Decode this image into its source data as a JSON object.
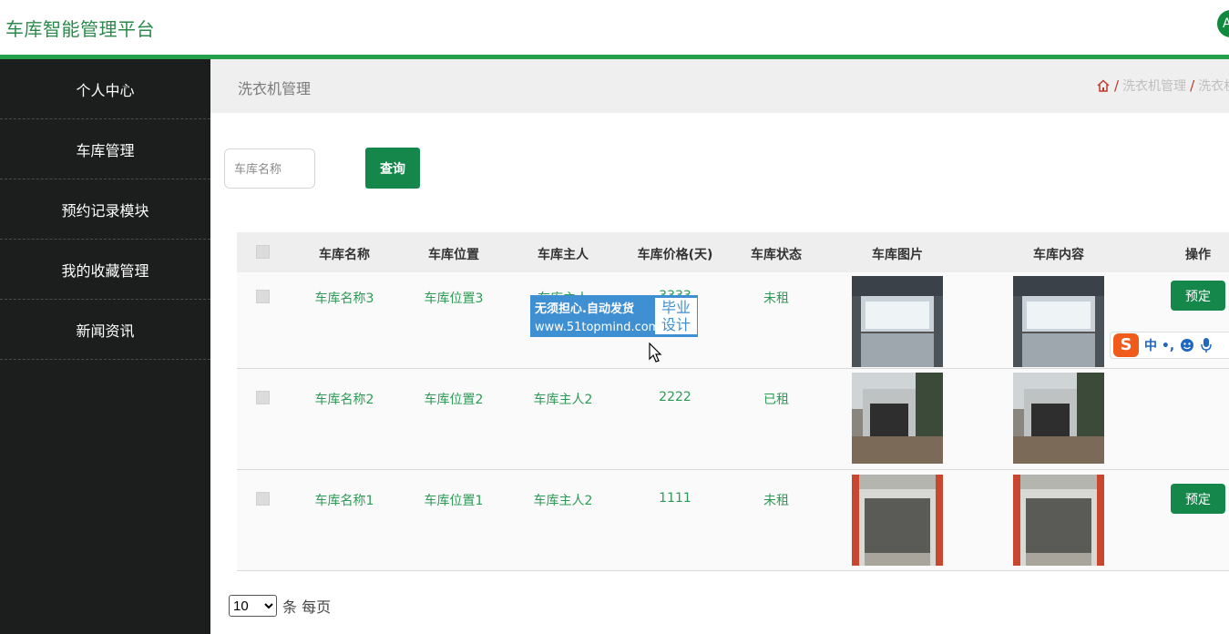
{
  "app": {
    "title": "车库智能管理平台",
    "avatar_letter": "A"
  },
  "sidebar": {
    "items": [
      {
        "label": "个人中心"
      },
      {
        "label": "车库管理"
      },
      {
        "label": "预约记录模块"
      },
      {
        "label": "我的收藏管理"
      },
      {
        "label": "新闻资讯"
      }
    ]
  },
  "page": {
    "title": "洗衣机管理",
    "breadcrumb": [
      "洗衣机管理",
      "洗衣机"
    ]
  },
  "search": {
    "placeholder": "车库名称",
    "button_label": "查询"
  },
  "table": {
    "headers": [
      "车库名称",
      "车库位置",
      "车库主人",
      "车库价格(天)",
      "车库状态",
      "车库图片",
      "车库内容",
      "操作"
    ],
    "rows": [
      {
        "name": "车库名称3",
        "location": "车库位置3",
        "owner": "车库主人",
        "price": "3333",
        "status": "未租",
        "action": "预定"
      },
      {
        "name": "车库名称2",
        "location": "车库位置2",
        "owner": "车库主人2",
        "price": "2222",
        "status": "已租",
        "action": ""
      },
      {
        "name": "车库名称1",
        "location": "车库位置1",
        "owner": "车库主人2",
        "price": "1111",
        "status": "未租",
        "action": "预定"
      }
    ]
  },
  "pagination": {
    "page_size": "10",
    "suffix": "条 每页"
  },
  "overlay": {
    "watermark_line1": "无须担心.自动发货",
    "watermark_line2": "www.51topmind.com",
    "watermark_tag1": "毕业",
    "watermark_tag2": "设计",
    "ime_label": "中 •,"
  },
  "colors": {
    "accent": "#15874b",
    "sidebar_bg": "#1c1e1d",
    "brand_line": "#24a04d"
  }
}
